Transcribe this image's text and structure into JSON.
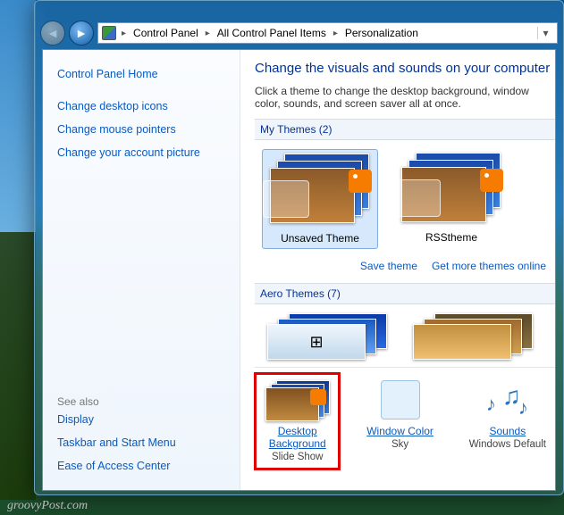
{
  "breadcrumb": {
    "b1": "Control Panel",
    "b2": "All Control Panel Items",
    "b3": "Personalization"
  },
  "sidebar": {
    "home": "Control Panel Home",
    "l1": "Change desktop icons",
    "l2": "Change mouse pointers",
    "l3": "Change your account picture",
    "see_also": "See also",
    "s1": "Display",
    "s2": "Taskbar and Start Menu",
    "s3": "Ease of Access Center"
  },
  "main": {
    "title": "Change the visuals and sounds on your computer",
    "desc": "Click a theme to change the desktop background, window color, sounds, and screen saver all at once.",
    "my_themes": "My Themes (2)",
    "theme1": "Unsaved Theme",
    "theme2": "RSStheme",
    "save": "Save theme",
    "get": "Get more themes online",
    "aero": "Aero Themes (7)"
  },
  "bottom": {
    "bg": "Desktop Background",
    "bg_sub": "Slide Show",
    "wc": "Window Color",
    "wc_sub": "Sky",
    "snd": "Sounds",
    "snd_sub": "Windows Default"
  },
  "watermark": "groovyPost.com"
}
